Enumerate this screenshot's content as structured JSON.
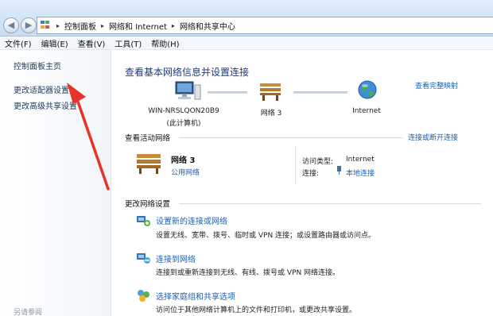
{
  "address": {
    "segments": [
      "控制面板",
      "网络和 Internet",
      "网络和共享中心"
    ],
    "arrow_glyph": "▸"
  },
  "menu": [
    "文件(F)",
    "编辑(E)",
    "查看(V)",
    "工具(T)",
    "帮助(H)"
  ],
  "sidebar": {
    "home": "控制面板主页",
    "change_adapter": "更改适配器设置",
    "advanced_sharing": "更改高级共享设置",
    "see_also": "另请参阅"
  },
  "main": {
    "title": "查看基本网络信息并设置连接",
    "view_full_map": "查看完整映射",
    "map": {
      "computer_name": "WIN-NRSLQON20B9",
      "computer_sub": "(此计算机)",
      "network_label": "网络  3",
      "internet_label": "Internet"
    },
    "active": {
      "section_title": "查看活动网络",
      "connect_disconnect": "连接或断开连接",
      "network_name": "网络  3",
      "network_type": "公用网络",
      "access_type_label": "访问类型:",
      "access_type_value": "Internet",
      "connection_label": "连接:",
      "connection_value": "本地连接"
    },
    "settings": {
      "section_title": "更改网络设置",
      "tasks": [
        {
          "link": "设置新的连接或网络",
          "desc": "设置无线、宽带、拨号、临时或 VPN 连接；或设置路由器或访问点。"
        },
        {
          "link": "连接到网络",
          "desc": "连接到或重新连接到无线、有线、拨号或 VPN 网络连接。"
        },
        {
          "link": "选择家庭组和共享选项",
          "desc": "访问位于其他网络计算机上的文件和打印机，或更改共享设置。"
        }
      ]
    }
  },
  "colors": {
    "link": "#1a5fb4",
    "title": "#1c3a82",
    "annotation_arrow": "#e8332b"
  }
}
